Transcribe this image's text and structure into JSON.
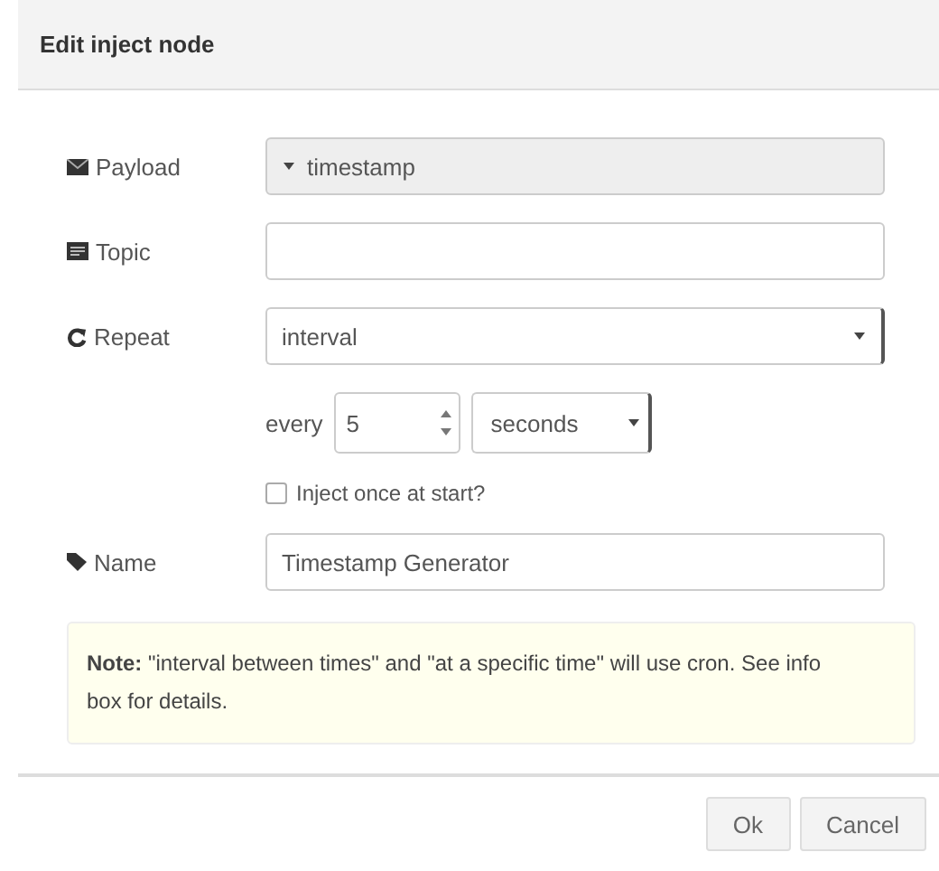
{
  "dialog": {
    "title": "Edit inject node"
  },
  "fields": [
    {
      "kind": "typed",
      "label": "Payload",
      "value": "timestamp"
    },
    {
      "kind": "text",
      "label": "Topic"
    },
    {
      "kind": "select",
      "label": "Repeat",
      "value": "interval"
    }
  ],
  "interval": {
    "prefix": "every",
    "amount": "5",
    "unit": "seconds"
  },
  "inject_once": {
    "label": "Inject once at start?",
    "checked": false
  },
  "name_field": {
    "label": "Name",
    "value": "Timestamp Generator"
  },
  "note": "**Note:** \"interval between times\" and \"at a specific time\" will use cron. See info box for details.",
  "buttons": [
    "Ok",
    "Cancel"
  ]
}
